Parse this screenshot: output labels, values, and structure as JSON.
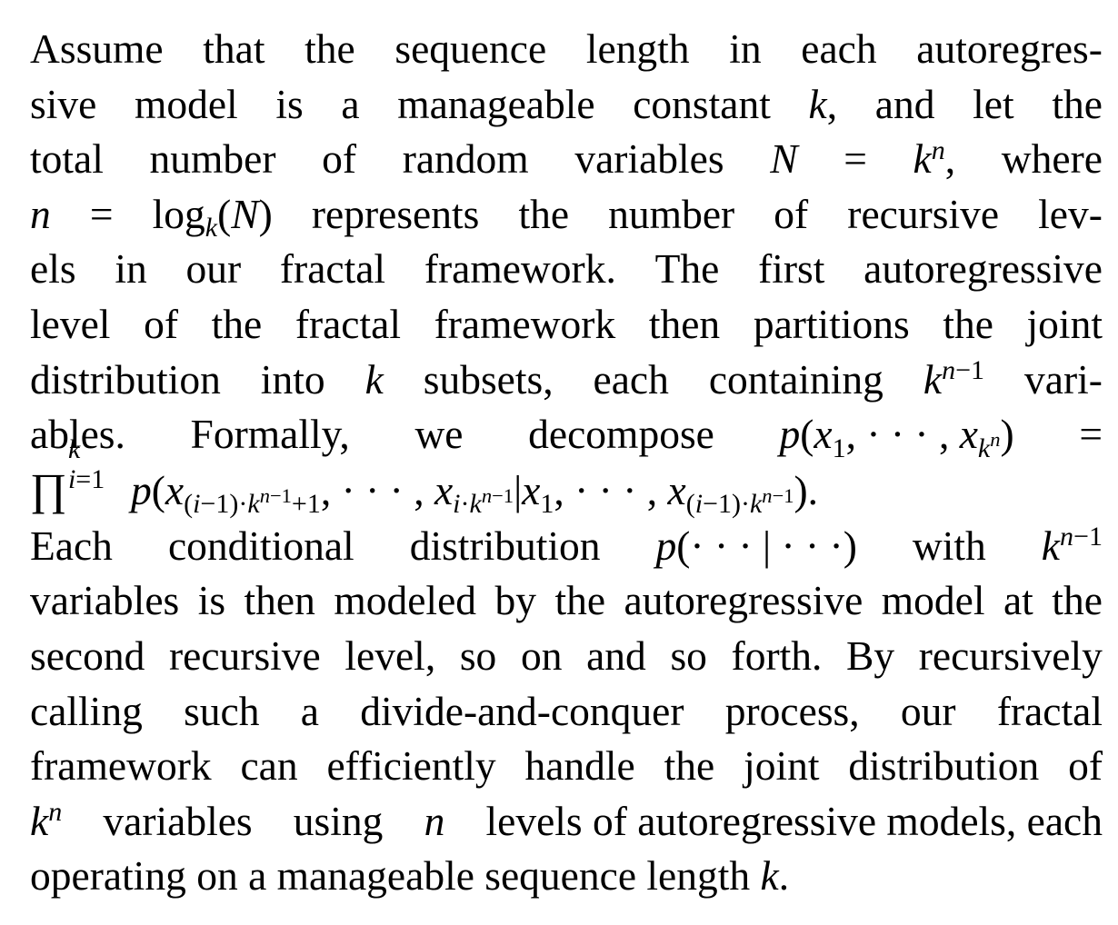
{
  "paragraph": {
    "lines": [
      [
        "Assume",
        "that",
        "the",
        "sequence",
        "length",
        "in",
        "each",
        "autoregres-"
      ],
      [
        "sive",
        "model",
        "is",
        "a",
        "manageable",
        "constant"
      ],
      [
        "total",
        "number",
        "of",
        "random",
        "variables"
      ],
      [
        "represents",
        "the",
        "number",
        "of",
        "recursive",
        "lev-"
      ],
      [
        "els",
        "in",
        "our",
        "fractal",
        "framework.",
        "The",
        "first",
        "autoregressive"
      ],
      [
        "level",
        "of",
        "the",
        "fractal",
        "framework",
        "then",
        "partitions",
        "the",
        "joint"
      ],
      [
        "distribution",
        "into"
      ],
      [
        "ables.",
        "Formally,",
        "we",
        "decompose"
      ],
      [],
      [
        "Each",
        "conditional",
        "distribution"
      ],
      [
        "variables",
        "is",
        "then",
        "modeled",
        "by",
        "the",
        "autoregressive",
        "model",
        "at",
        "the"
      ],
      [
        "second",
        "recursive",
        "level,",
        "so",
        "on",
        "and",
        "so",
        "forth.",
        "By",
        "recursively"
      ],
      [
        "calling",
        "such",
        "a",
        "divide-and-conquer",
        "process,",
        "our",
        "fractal"
      ],
      [
        "framework",
        "can",
        "efficiently",
        "handle",
        "the",
        "joint",
        "distribution",
        "of"
      ],
      [
        "variables",
        "using"
      ],
      [
        "operating on a manageable sequence length"
      ]
    ],
    "fragments": {
      "l2_and_let_the": [
        "and",
        "let",
        "the"
      ],
      "where": "where",
      "subsets": "subsets,",
      "each_containing": [
        "each",
        "containing"
      ],
      "vari": "vari-",
      "with": "with",
      "levels_tail": "levels of autoregressive models, each"
    }
  }
}
